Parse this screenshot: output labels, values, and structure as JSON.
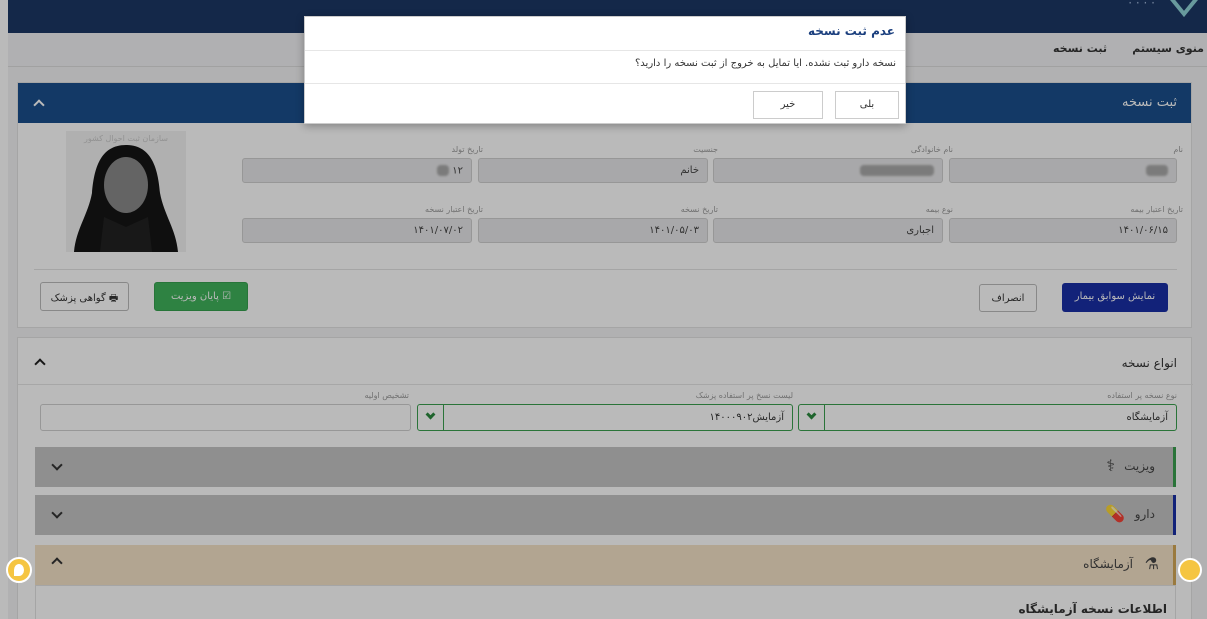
{
  "header": {
    "menu_system": "منوی سیستم",
    "menu_rx": "ثبت نسخه"
  },
  "patient_card": {
    "title": "ثبت نسخه",
    "fields": {
      "name_label": "نام",
      "family_label": "نام خانوادگی",
      "gender_label": "جنسیت",
      "gender_value": "خانم",
      "birth_label": "تاریخ تولد",
      "birth_value": "۱۲",
      "insurance_validity_label": "تاریخ اعتبار بیمه",
      "insurance_validity_value": "۱۴۰۱/۰۶/۱۵",
      "insurance_type_label": "نوع بیمه",
      "insurance_type_value": "اجباری",
      "rx_date_label": "تاریخ نسخه",
      "rx_date_value": "۱۴۰۱/۰۵/۰۳",
      "rx_validity_label": "تاریخ اعتبار نسخه",
      "rx_validity_value": "۱۴۰۱/۰۷/۰۲"
    },
    "photo_watermark": "سازمان ثبت احوال کشور",
    "buttons": {
      "history": "نمایش سوابق بیمار",
      "cancel": "انصراف",
      "end_visit": "پایان ویزیت",
      "certificate": "گواهی پزشک"
    }
  },
  "rx_types": {
    "title": "انواع نسخه",
    "type_label": "نوع نسخه پر استفاده",
    "type_value": "آزمایشگاه",
    "list_label": "لیست نسخ پر استفاده پزشک",
    "list_value": "آزمایش۱۴۰۰۰۹۰۲",
    "diagnosis_label": "تشخیص اولیه",
    "diagnosis_value": "",
    "sections": {
      "visit": "ویزیت",
      "drug": "دارو",
      "lab": "آزمایشگاه"
    },
    "lab_info_title": "اطلاعات نسخه آزمایشگاه"
  },
  "modal": {
    "title": "عدم ثبت نسخه",
    "message": "نسخه دارو ثبت نشده. ایا تمایل به خروج از ثبت نسخه را دارید؟",
    "yes": "بلی",
    "no": "خیر"
  },
  "colors": {
    "header_blue": "#1b4f8c",
    "primary_button": "#1a2fa6",
    "success_green": "#3fb35b",
    "lab_section_bg": "#f4e2c7"
  }
}
